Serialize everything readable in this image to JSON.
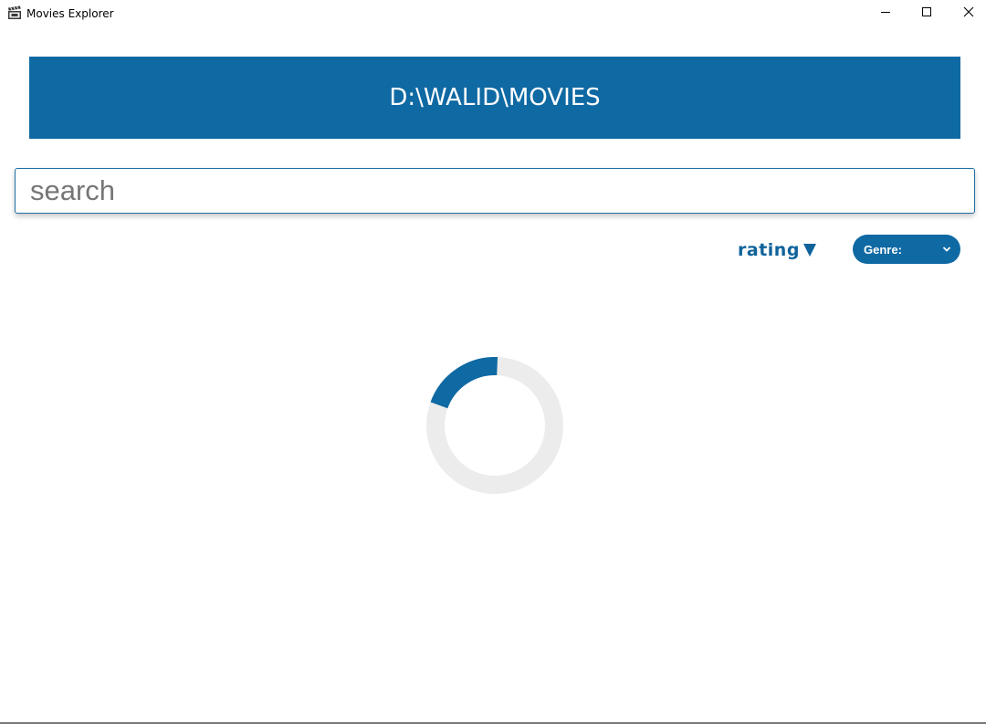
{
  "window": {
    "title": "Movies Explorer",
    "icon": "clapperboard-icon",
    "controls": [
      "minimize-icon",
      "maximize-icon",
      "close-icon"
    ]
  },
  "header": {
    "path": "D:\\WALID\\MOVIES"
  },
  "search": {
    "placeholder": "search",
    "value": ""
  },
  "sort": {
    "label": "rating",
    "direction": "descending",
    "icon": "triangle-down-icon"
  },
  "genre_select": {
    "selected": "Genre:",
    "icon": "chevron-down-icon"
  },
  "loading": {
    "state": "loading",
    "icon": "spinner-icon"
  },
  "colors": {
    "accent": "#0f69a3",
    "accent_text": "#10639a",
    "spinner_track": "#ececec",
    "background": "#ffffff"
  }
}
